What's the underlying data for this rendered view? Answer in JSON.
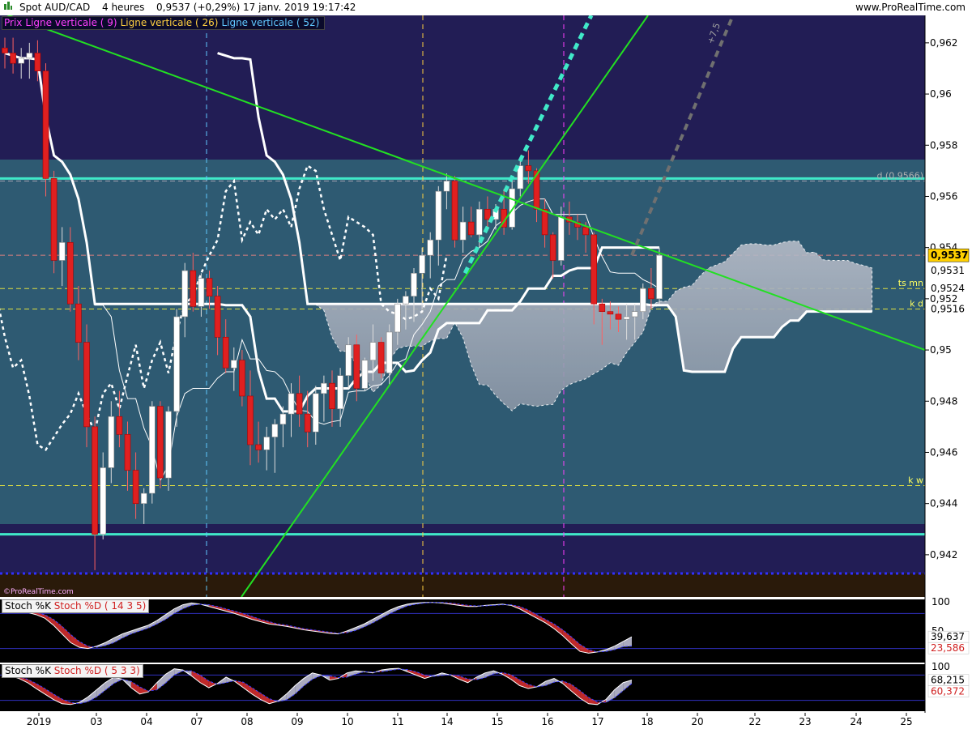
{
  "header": {
    "symbol": "Spot AUD/CAD",
    "timeframe": "4 heures",
    "price": "0,9537 (+0,29%)",
    "datetime": "17 janv. 2019 19:17:42",
    "site": "www.ProRealTime.com"
  },
  "legend": [
    {
      "label": "Prix",
      "color": "#ff40ff"
    },
    {
      "label": "Ligne verticale ( 9)",
      "color": "#ff40ff"
    },
    {
      "label": "Ligne verticale ( 26)",
      "color": "#ffd040"
    },
    {
      "label": "Ligne verticale ( 52)",
      "color": "#60c8ff"
    }
  ],
  "watermark": "©ProRealTime.com",
  "colors": {
    "up_candle": "#ffffff",
    "down_candle": "#e02020",
    "cloud": "#c8c8d4",
    "box": "#2e5a72",
    "background": "#221d55",
    "trendline": "#22e022",
    "horizontal_level": "#40e8c8",
    "dotted_projection": "#40e8c8"
  },
  "chart_data": [
    {
      "type": "candlestick",
      "title": "Spot AUD/CAD",
      "ylim": [
        0.9407,
        0.9628
      ],
      "y_ticks": [
        "0,962",
        "0,96",
        "0,958",
        "0,956",
        "0,954",
        "0,952",
        "0,95",
        "0,948",
        "0,946",
        "0,944",
        "0,942"
      ],
      "x_ticks": [
        "2019",
        "03",
        "04",
        "07",
        "08",
        "09",
        "10",
        "11",
        "14",
        "15",
        "16",
        "17",
        "18",
        "20",
        "22",
        "23",
        "24",
        "25"
      ],
      "price_labels": [
        {
          "text": "0,9537",
          "value": 0.9537,
          "highlight": true
        },
        {
          "text": "0,9531",
          "value": 0.9531
        },
        {
          "text": "0,9524",
          "value": 0.9524
        },
        {
          "text": "0,9516",
          "value": 0.9516
        }
      ],
      "annotations": [
        {
          "text": "d (0,9566)",
          "value": 0.9566
        },
        {
          "text": "ts mn",
          "value": 0.9524
        },
        {
          "text": "k d",
          "value": 0.9516
        },
        {
          "text": "k w",
          "value": 0.9447
        },
        {
          "text": "+7,5",
          "value": 0.962
        }
      ],
      "levels": [
        {
          "name": "upper",
          "value": 0.9567
        },
        {
          "name": "lower",
          "value": 0.9428
        }
      ],
      "candles": [
        [
          0.9618,
          0.9622,
          0.961,
          0.9616
        ],
        [
          0.9616,
          0.9622,
          0.9608,
          0.9612
        ],
        [
          0.9612,
          0.9618,
          0.9606,
          0.9614
        ],
        [
          0.9614,
          0.962,
          0.9606,
          0.9616
        ],
        [
          0.9616,
          0.9621,
          0.9605,
          0.9609
        ],
        [
          0.9609,
          0.9612,
          0.956,
          0.9567
        ],
        [
          0.9567,
          0.957,
          0.953,
          0.9535
        ],
        [
          0.9535,
          0.9548,
          0.9525,
          0.9542
        ],
        [
          0.9542,
          0.9548,
          0.9515,
          0.9518
        ],
        [
          0.9518,
          0.9525,
          0.9496,
          0.9503
        ],
        [
          0.9503,
          0.951,
          0.9462,
          0.947
        ],
        [
          0.947,
          0.9474,
          0.9414,
          0.9428
        ],
        [
          0.9428,
          0.946,
          0.9426,
          0.9454
        ],
        [
          0.9454,
          0.948,
          0.9448,
          0.9474
        ],
        [
          0.9474,
          0.9484,
          0.9462,
          0.9467
        ],
        [
          0.9467,
          0.9472,
          0.9445,
          0.9453
        ],
        [
          0.9453,
          0.946,
          0.9434,
          0.944
        ],
        [
          0.944,
          0.9446,
          0.9432,
          0.9444
        ],
        [
          0.9444,
          0.948,
          0.944,
          0.9478
        ],
        [
          0.9478,
          0.948,
          0.9446,
          0.945
        ],
        [
          0.945,
          0.9478,
          0.9445,
          0.9476
        ],
        [
          0.9476,
          0.9516,
          0.947,
          0.9513
        ],
        [
          0.9513,
          0.9534,
          0.9505,
          0.9531
        ],
        [
          0.9531,
          0.9538,
          0.9515,
          0.9517
        ],
        [
          0.9517,
          0.953,
          0.9513,
          0.9528
        ],
        [
          0.9528,
          0.9531,
          0.9516,
          0.9521
        ],
        [
          0.9521,
          0.9525,
          0.9498,
          0.9505
        ],
        [
          0.9505,
          0.9512,
          0.9491,
          0.9493
        ],
        [
          0.9493,
          0.9501,
          0.9484,
          0.9496
        ],
        [
          0.9496,
          0.95,
          0.9478,
          0.9482
        ],
        [
          0.9482,
          0.9492,
          0.9455,
          0.9463
        ],
        [
          0.9463,
          0.9472,
          0.9456,
          0.9461
        ],
        [
          0.9461,
          0.947,
          0.9453,
          0.9466
        ],
        [
          0.9466,
          0.9473,
          0.9452,
          0.9471
        ],
        [
          0.9471,
          0.9478,
          0.9462,
          0.9475
        ],
        [
          0.9475,
          0.9487,
          0.9466,
          0.9483
        ],
        [
          0.9483,
          0.949,
          0.947,
          0.9475
        ],
        [
          0.9475,
          0.9484,
          0.9462,
          0.9468
        ],
        [
          0.9468,
          0.9486,
          0.9463,
          0.9483
        ],
        [
          0.9483,
          0.949,
          0.9472,
          0.9487
        ],
        [
          0.9487,
          0.9492,
          0.947,
          0.9477
        ],
        [
          0.9477,
          0.9493,
          0.947,
          0.949
        ],
        [
          0.949,
          0.9505,
          0.9485,
          0.9502
        ],
        [
          0.9502,
          0.9506,
          0.948,
          0.9485
        ],
        [
          0.9485,
          0.9497,
          0.9484,
          0.9496
        ],
        [
          0.9496,
          0.951,
          0.9488,
          0.9503
        ],
        [
          0.9503,
          0.9505,
          0.9489,
          0.9491
        ],
        [
          0.9491,
          0.951,
          0.9486,
          0.9507
        ],
        [
          0.9507,
          0.952,
          0.9502,
          0.9518
        ],
        [
          0.9518,
          0.9523,
          0.9508,
          0.9521
        ],
        [
          0.9521,
          0.9532,
          0.9511,
          0.953
        ],
        [
          0.953,
          0.954,
          0.9516,
          0.9537
        ],
        [
          0.9537,
          0.9546,
          0.9528,
          0.9543
        ],
        [
          0.9543,
          0.9564,
          0.9533,
          0.9562
        ],
        [
          0.9562,
          0.9569,
          0.9555,
          0.9566
        ],
        [
          0.9566,
          0.9568,
          0.954,
          0.9543
        ],
        [
          0.9543,
          0.9556,
          0.9538,
          0.955
        ],
        [
          0.955,
          0.9556,
          0.9544,
          0.9545
        ],
        [
          0.9545,
          0.9558,
          0.954,
          0.9555
        ],
        [
          0.9555,
          0.956,
          0.9548,
          0.9551
        ],
        [
          0.9551,
          0.9557,
          0.9547,
          0.9555
        ],
        [
          0.9555,
          0.9563,
          0.9545,
          0.9548
        ],
        [
          0.9548,
          0.9566,
          0.9547,
          0.9563
        ],
        [
          0.9563,
          0.9575,
          0.956,
          0.9572
        ],
        [
          0.9572,
          0.9578,
          0.9565,
          0.957
        ],
        [
          0.957,
          0.9571,
          0.955,
          0.9555
        ],
        [
          0.9555,
          0.9559,
          0.954,
          0.9545
        ],
        [
          0.9545,
          0.9546,
          0.9528,
          0.9535
        ],
        [
          0.9535,
          0.9556,
          0.9533,
          0.9552
        ],
        [
          0.9552,
          0.9558,
          0.9545,
          0.955
        ],
        [
          0.955,
          0.9553,
          0.9543,
          0.9548
        ],
        [
          0.9548,
          0.955,
          0.9538,
          0.9545
        ],
        [
          0.9545,
          0.9546,
          0.951,
          0.9518
        ],
        [
          0.9518,
          0.952,
          0.9502,
          0.9515
        ],
        [
          0.9515,
          0.9519,
          0.9508,
          0.9514
        ],
        [
          0.9514,
          0.9517,
          0.9507,
          0.9512
        ],
        [
          0.9512,
          0.9518,
          0.9504,
          0.9513
        ],
        [
          0.9513,
          0.9518,
          0.9504,
          0.9515
        ],
        [
          0.9515,
          0.9526,
          0.9512,
          0.9524
        ],
        [
          0.9524,
          0.9532,
          0.9516,
          0.952
        ],
        [
          0.952,
          0.954,
          0.9518,
          0.9537
        ]
      ]
    },
    {
      "type": "area",
      "title": "Stoch %K Stoch %D ( 14 3 5)",
      "series_names": [
        "Stoch %K",
        "Stoch %D ( 14 3 5)"
      ],
      "ylim": [
        0,
        100
      ],
      "y_ticks": [
        "100",
        "50"
      ],
      "last_values": [
        "39,637",
        "23,586"
      ],
      "k": [
        90,
        88,
        85,
        82,
        78,
        72,
        60,
        45,
        30,
        22,
        20,
        24,
        30,
        38,
        45,
        50,
        55,
        60,
        68,
        78,
        88,
        95,
        98,
        96,
        92,
        88,
        84,
        80,
        75,
        70,
        66,
        62,
        60,
        58,
        55,
        52,
        50,
        48,
        46,
        45,
        50,
        56,
        62,
        70,
        78,
        86,
        92,
        96,
        98,
        99,
        99,
        98,
        96,
        94,
        92,
        92,
        94,
        95,
        96,
        94,
        88,
        80,
        72,
        64,
        54,
        42,
        28,
        15,
        12,
        14,
        18,
        24,
        32,
        40
      ],
      "d": [
        86,
        86,
        86,
        84,
        82,
        78,
        70,
        58,
        44,
        32,
        24,
        22,
        25,
        30,
        38,
        45,
        50,
        55,
        62,
        70,
        80,
        88,
        94,
        96,
        95,
        92,
        88,
        84,
        80,
        75,
        70,
        66,
        62,
        60,
        57,
        54,
        52,
        50,
        48,
        46,
        47,
        51,
        57,
        64,
        72,
        80,
        87,
        93,
        96,
        98,
        99,
        99,
        98,
        96,
        94,
        93,
        93,
        94,
        95,
        95,
        92,
        86,
        78,
        70,
        62,
        52,
        40,
        27,
        18,
        14,
        15,
        18,
        23,
        24
      ]
    },
    {
      "type": "area",
      "title": "Stoch %K Stoch %D ( 5 3 3)",
      "series_names": [
        "Stoch %K",
        "Stoch %D ( 5 3 3)"
      ],
      "ylim": [
        0,
        100
      ],
      "y_ticks": [
        "100"
      ],
      "last_values": [
        "68,215",
        "60,372"
      ],
      "k": [
        80,
        78,
        72,
        62,
        48,
        35,
        22,
        12,
        10,
        15,
        28,
        45,
        62,
        75,
        70,
        50,
        35,
        40,
        62,
        82,
        95,
        92,
        78,
        62,
        50,
        60,
        75,
        65,
        50,
        35,
        22,
        12,
        18,
        35,
        55,
        72,
        85,
        80,
        68,
        72,
        85,
        90,
        88,
        85,
        92,
        95,
        96,
        88,
        80,
        72,
        78,
        85,
        80,
        70,
        62,
        75,
        85,
        90,
        82,
        70,
        55,
        48,
        52,
        65,
        72,
        60,
        42,
        25,
        12,
        10,
        22,
        45,
        62,
        68
      ],
      "d": [
        78,
        78,
        76,
        70,
        60,
        48,
        35,
        23,
        15,
        12,
        17,
        28,
        44,
        60,
        70,
        65,
        52,
        42,
        45,
        61,
        80,
        90,
        90,
        80,
        66,
        58,
        62,
        67,
        63,
        50,
        37,
        24,
        17,
        21,
        35,
        54,
        70,
        79,
        78,
        74,
        75,
        82,
        88,
        87,
        88,
        91,
        94,
        93,
        88,
        80,
        77,
        79,
        81,
        78,
        71,
        69,
        74,
        83,
        86,
        81,
        69,
        58,
        52,
        55,
        63,
        66,
        58,
        43,
        27,
        16,
        15,
        26,
        43,
        60
      ]
    }
  ]
}
